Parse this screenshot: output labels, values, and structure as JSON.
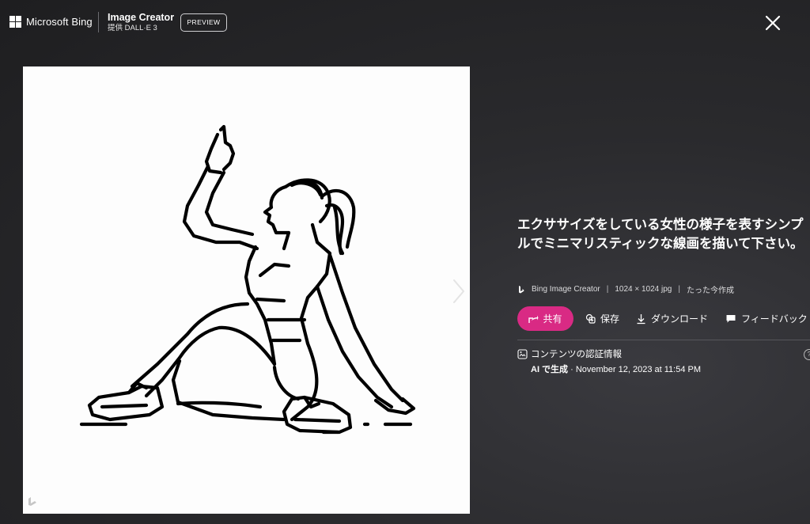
{
  "header": {
    "brand_label": "Microsoft Bing",
    "product_title": "Image Creator",
    "product_subtitle": "提供 DALL·E 3",
    "badge_label": "PREVIEW",
    "close_icon": "close-icon"
  },
  "image": {
    "alt": "エクササイズをしている女性の様子を表すシンプルでミニマリスティックな線画"
  },
  "details": {
    "prompt_text": "エクササイズをしている女性の様子を表すシンプルでミニマリスティックな線画を描いて下さい。",
    "source": "Bing Image Creator",
    "separator": "|",
    "dimensions": "1024 × 1024 jpg",
    "created": "たった今作成",
    "share_label": "共有",
    "save_label": "保存",
    "download_label": "ダウンロード",
    "feedback_label": "フィードバック",
    "credentials_title": "コンテンツの認証情報",
    "ai_label": "AI で生成",
    "ai_date": "· November 12, 2023 at 11:54 PM",
    "help_label": "?"
  },
  "colors": {
    "share_button": "#d92a84",
    "background": "#2a2a2d"
  }
}
